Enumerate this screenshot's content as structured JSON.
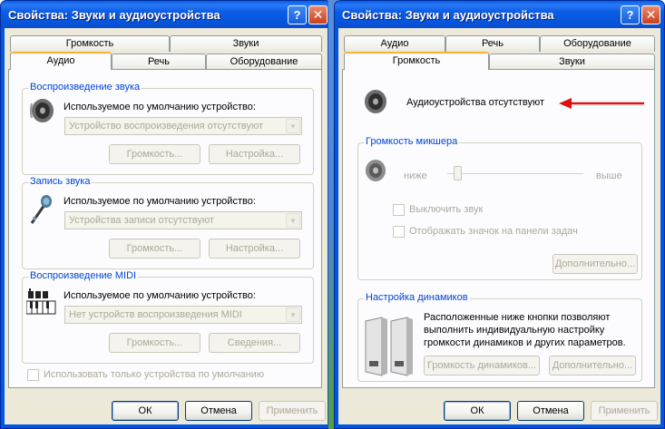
{
  "left": {
    "title": "Свойства: Звуки и аудиоустройства",
    "tabs_top": [
      "Громкость",
      "Звуки"
    ],
    "tabs_bottom": [
      "Аудио",
      "Речь",
      "Оборудование"
    ],
    "playback": {
      "title": "Воспроизведение звука",
      "label": "Используемое по умолчанию устройство:",
      "value": "Устройство воспроизведения отсутствуют",
      "btn1": "Громкость...",
      "btn2": "Настройка..."
    },
    "record": {
      "title": "Запись звука",
      "label": "Используемое по умолчанию устройство:",
      "value": "Устройства записи отсутствуют",
      "btn1": "Громкость...",
      "btn2": "Настройка..."
    },
    "midi": {
      "title": "Воспроизведение MIDI",
      "label": "Используемое по умолчанию устройство:",
      "value": "Нет устройств воспроизведения MIDI",
      "btn1": "Громкость...",
      "btn2": "Сведения..."
    },
    "only_default": "Использовать только устройства по умолчанию",
    "ok": "ОК",
    "cancel": "Отмена",
    "apply": "Применить"
  },
  "right": {
    "title": "Свойства: Звуки и аудиоустройства",
    "tabs_top": [
      "Аудио",
      "Речь",
      "Оборудование"
    ],
    "tabs_bottom": [
      "Громкость",
      "Звуки"
    ],
    "no_devices": "Аудиоустройства отсутствуют",
    "mixer": {
      "title": "Громкость микшера",
      "low": "ниже",
      "high": "выше",
      "mute": "Выключить звук",
      "show_icon": "Отображать значок на панели задач",
      "advanced": "Дополнительно...",
      "volume_level": 0.05
    },
    "speakers": {
      "title": "Настройка динамиков",
      "description_lines": [
        "Расположенные ниже кнопки позволяют",
        "выполнить индивидуальную настройку",
        "громкости динамиков и других параметров."
      ],
      "btn_volume": "Громкость динамиков...",
      "btn_advanced": "Дополнительно..."
    },
    "ok": "ОК",
    "cancel": "Отмена",
    "apply": "Применить"
  },
  "colors": {
    "title_bar": "#0055e5",
    "group_title": "#0046d5",
    "arrow": "#e01010",
    "active_tab_accent": "#f8b236"
  }
}
